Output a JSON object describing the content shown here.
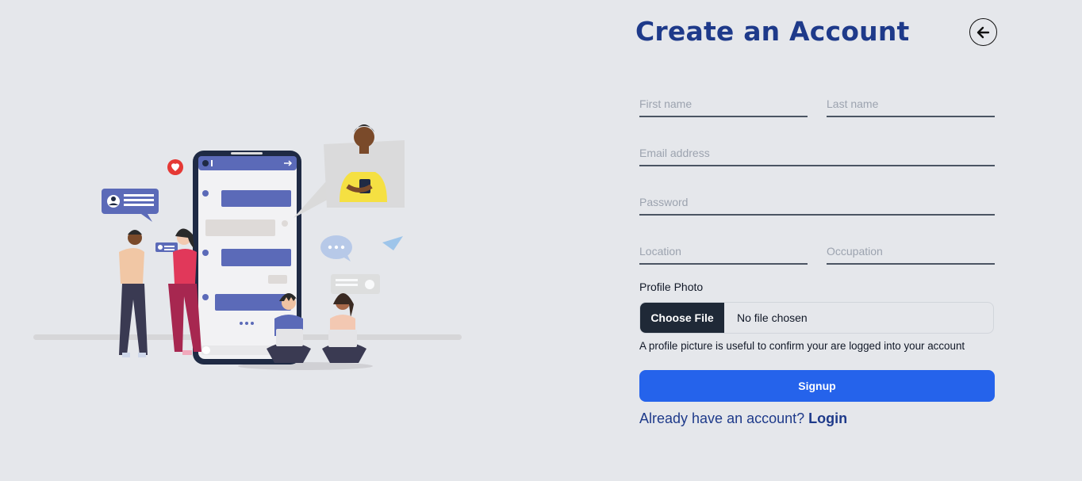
{
  "form": {
    "title": "Create an Account",
    "first_name_placeholder": "First name",
    "last_name_placeholder": "Last name",
    "email_placeholder": "Email address",
    "password_placeholder": "Password",
    "location_placeholder": "Location",
    "occupation_placeholder": "Occupation",
    "profile_photo_label": "Profile Photo",
    "choose_file_label": "Choose File",
    "no_file_text": "No file chosen",
    "helper_text": "A profile picture is useful to confirm your are logged into your account",
    "signup_label": "Signup",
    "login_prompt": "Already have an account?",
    "login_link": "Login"
  },
  "icons": {
    "back": "arrow-left-icon"
  },
  "colors": {
    "background": "#e5e7eb",
    "title": "#1e3a8a",
    "primary_button": "#2563eb",
    "file_button": "#1f2937",
    "illustration_accent": "#5b6ab8"
  }
}
